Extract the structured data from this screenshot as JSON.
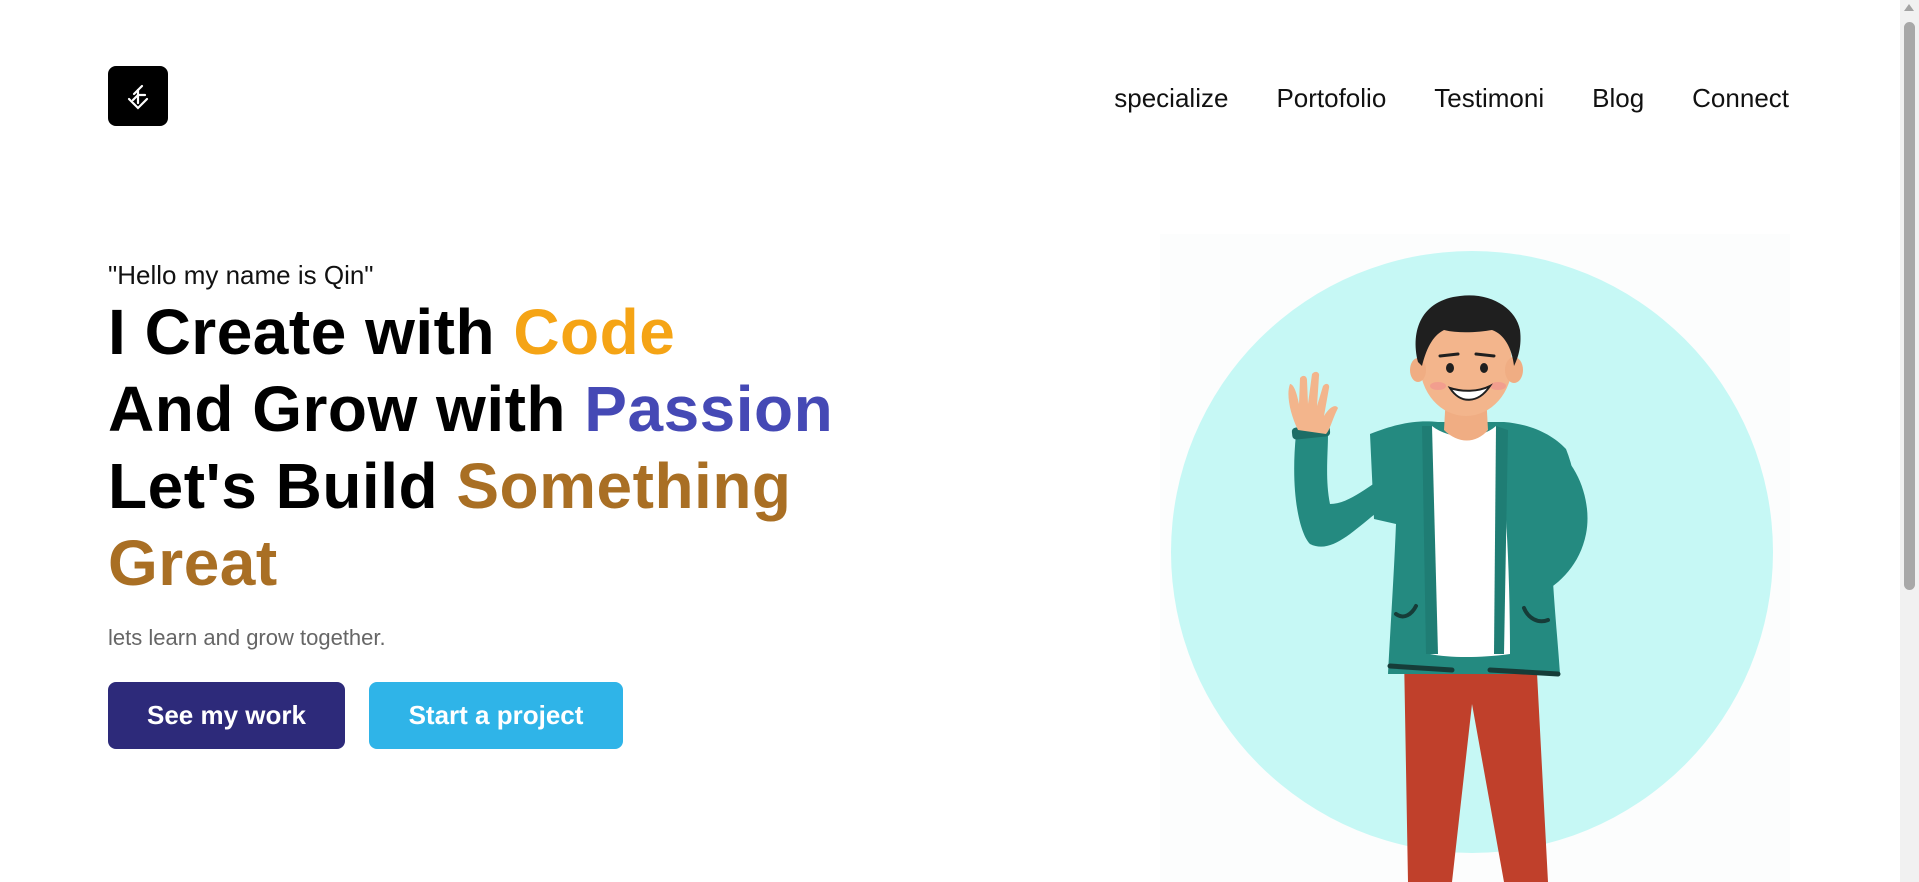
{
  "header": {
    "logo_icon": "stylized-letter-logo-icon",
    "nav": [
      {
        "label": "specialize"
      },
      {
        "label": "Portofolio"
      },
      {
        "label": "Testimoni"
      },
      {
        "label": "Blog"
      },
      {
        "label": "Connect"
      }
    ]
  },
  "hero": {
    "greeting": "\"Hello my name is Qin\"",
    "line1_plain": "I Create with ",
    "line1_accent": "Code",
    "line2_plain": "And Grow with ",
    "line2_accent": "Passion",
    "line3_plain": "Let's Build ",
    "line3_accent": "Something",
    "line4_accent": "Great",
    "subtext": "lets learn and grow together.",
    "primary_button": "See my work",
    "secondary_button": "Start a project"
  },
  "illustration": {
    "description_icon": "waving-man-illustration"
  },
  "colors": {
    "code_accent": "#f5a415",
    "passion_accent": "#4549b5",
    "something_accent": "#a96f24",
    "primary_button": "#2d2a7a",
    "secondary_button": "#2fb4e8",
    "circle": "#c6f8f5",
    "jacket": "#248a80",
    "pants": "#c0402b"
  }
}
